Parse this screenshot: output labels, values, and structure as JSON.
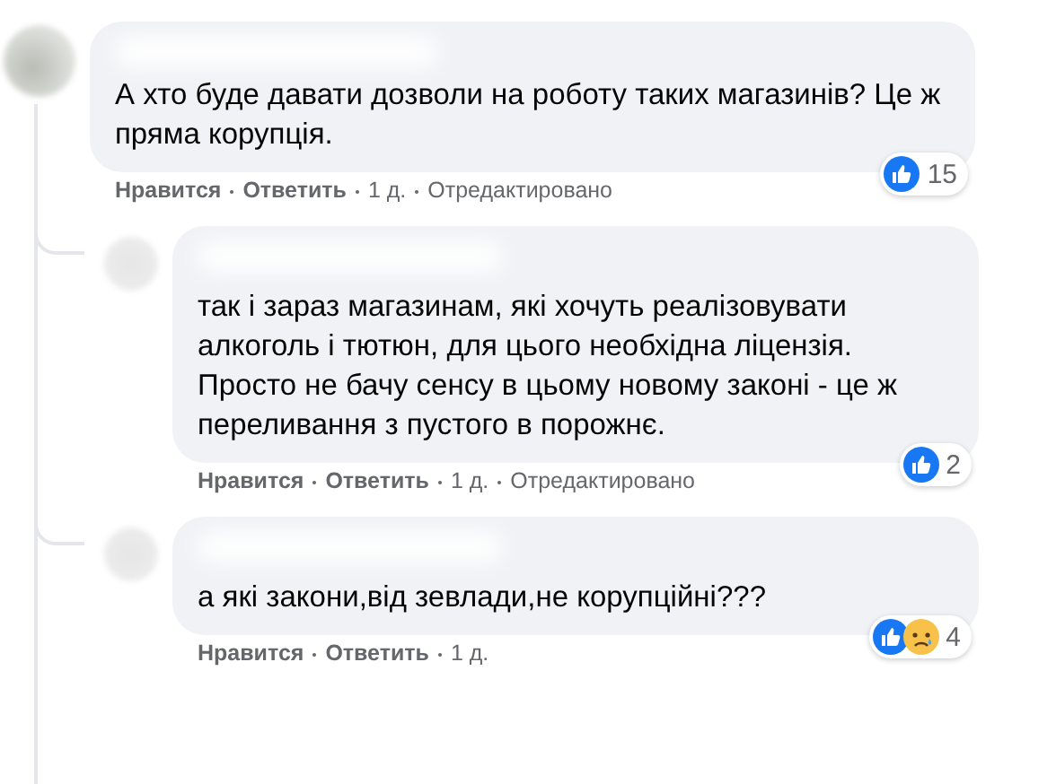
{
  "comment": {
    "text": "А хто буде давати дозволи на роботу таких магазинів? Це ж пряма корупція.",
    "actions": [
      {
        "label": "Нравится",
        "kind": "link"
      },
      {
        "label": "Ответить",
        "kind": "link"
      },
      {
        "label": "1 д.",
        "kind": "time"
      },
      {
        "label": "Отредактировано",
        "kind": "note"
      }
    ],
    "reactions": [
      {
        "kind": "like"
      }
    ],
    "reaction_count": "15"
  },
  "replies": [
    {
      "text": "так і зараз магазинам, які хочуть реалізовувати алкоголь і тютюн, для цього необхідна ліцензія. Просто не бачу сенсу в цьому новому законі - це ж переливання з пустого в порожнє.",
      "actions": [
        {
          "label": "Нравится",
          "kind": "link"
        },
        {
          "label": "Ответить",
          "kind": "link"
        },
        {
          "label": "1 д.",
          "kind": "time"
        },
        {
          "label": "Отредактировано",
          "kind": "note"
        }
      ],
      "reactions": [
        {
          "kind": "like"
        }
      ],
      "reaction_count": "2"
    },
    {
      "text": "а які закони,від зевлади,не корупційні???",
      "actions": [
        {
          "label": "Нравится",
          "kind": "link"
        },
        {
          "label": "Ответить",
          "kind": "link"
        },
        {
          "label": "1 д.",
          "kind": "time"
        }
      ],
      "reactions": [
        {
          "kind": "like"
        },
        {
          "kind": "sad"
        }
      ],
      "reaction_count": "4"
    }
  ]
}
